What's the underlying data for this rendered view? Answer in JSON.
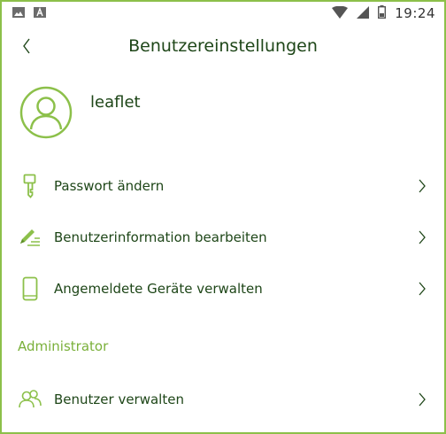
{
  "statusbar": {
    "time": "19:24",
    "left_icons": [
      "image-icon",
      "font-icon"
    ],
    "right_icons": [
      "wifi-icon",
      "signal-icon",
      "battery-icon"
    ]
  },
  "header": {
    "title": "Benutzereinstellungen",
    "back_icon": "chevron-left-icon"
  },
  "profile": {
    "username": "leaflet",
    "avatar_icon": "user-avatar-icon"
  },
  "menu": {
    "items": [
      {
        "label": "Passwort ändern",
        "icon": "key-icon"
      },
      {
        "label": "Benutzerinformation bearbeiten",
        "icon": "edit-icon"
      },
      {
        "label": "Angemeldete Geräte verwalten",
        "icon": "phone-icon"
      }
    ]
  },
  "admin": {
    "section_title": "Administrator",
    "items": [
      {
        "label": "Benutzer verwalten",
        "icon": "users-icon"
      }
    ]
  },
  "colors": {
    "accent": "#8cc04a",
    "text_dark": "#1e4618",
    "section": "#7ab03a"
  }
}
